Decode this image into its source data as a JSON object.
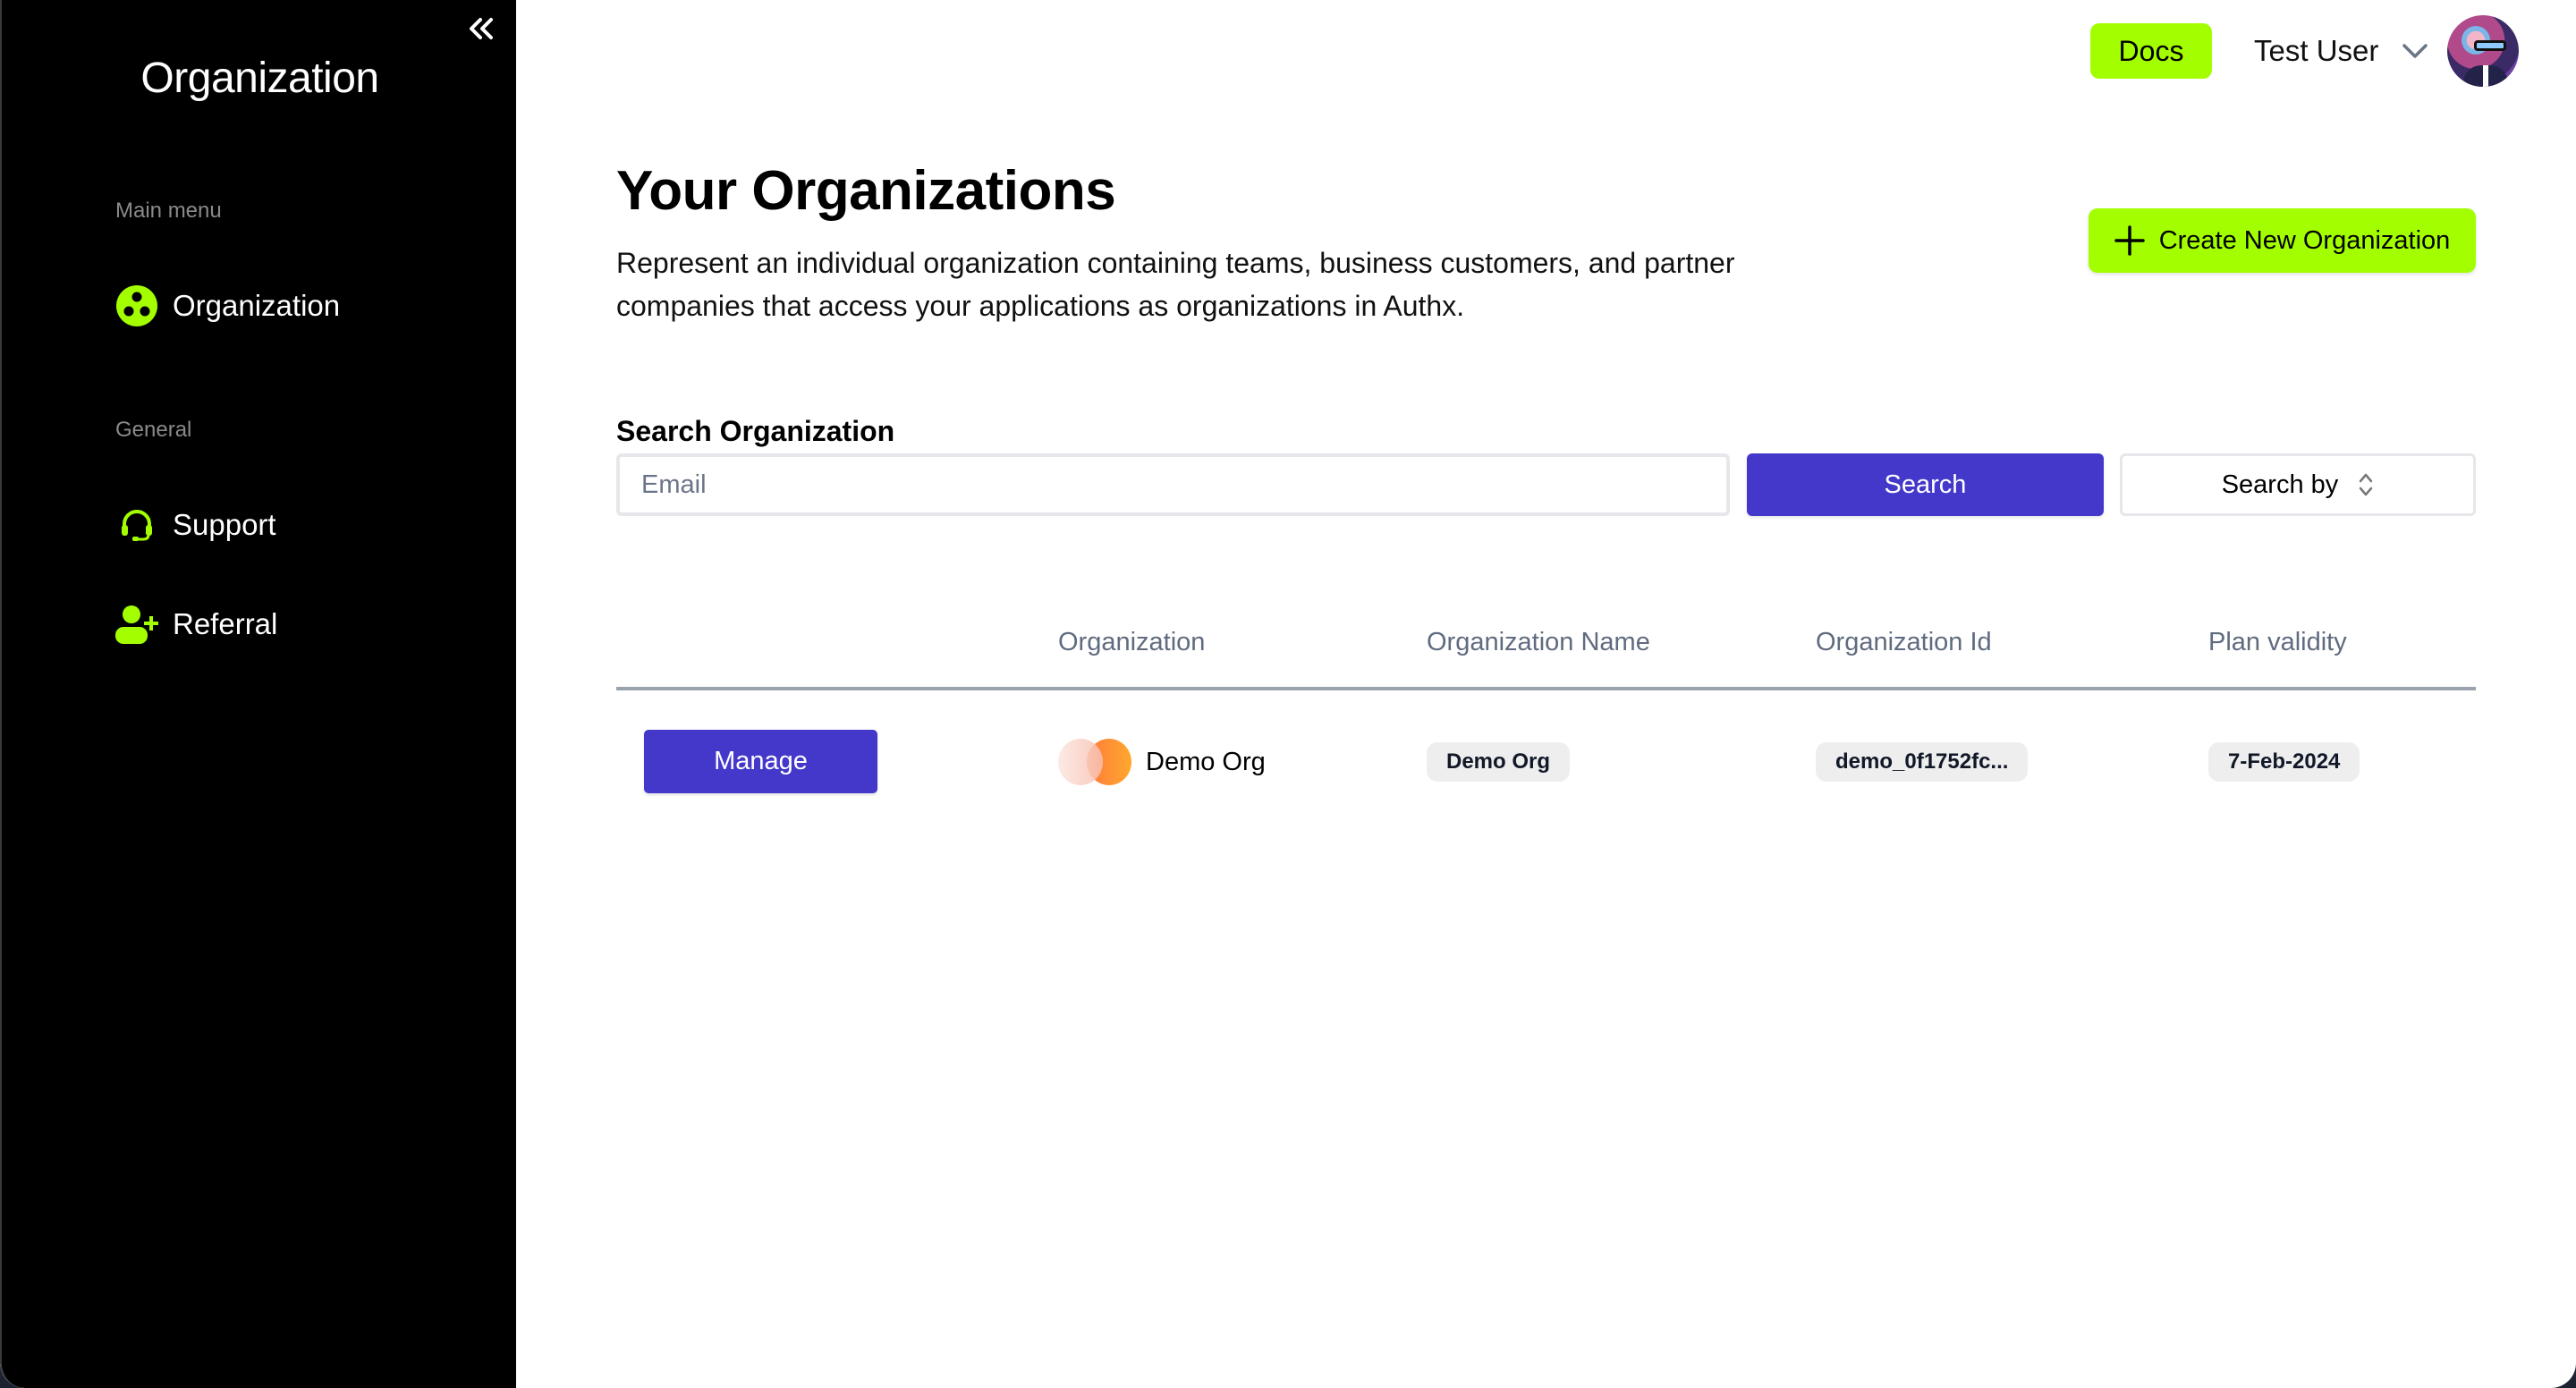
{
  "sidebar": {
    "title": "Organization",
    "collapse_icon": "double-chevron-left-icon",
    "sections": [
      {
        "label": "Main menu",
        "items": [
          {
            "label": "Organization",
            "icon": "organization-icon",
            "active": true
          }
        ]
      },
      {
        "label": "General",
        "items": [
          {
            "label": "Support",
            "icon": "headset-icon"
          },
          {
            "label": "Referral",
            "icon": "user-plus-icon"
          }
        ]
      }
    ]
  },
  "topbar": {
    "docs_label": "Docs",
    "user_name": "Test User",
    "user_menu_icon": "chevron-down-icon",
    "avatar": "user-avatar"
  },
  "header": {
    "title": "Your Organizations",
    "description": "Represent an individual organization containing teams, business customers, and partner companies that access your applications as organizations in Authx.",
    "create_button_label": "Create New Organization"
  },
  "search": {
    "label": "Search Organization",
    "input_value": "",
    "input_placeholder": "Email",
    "search_button_label": "Search",
    "search_by_label": "Search by"
  },
  "table": {
    "columns": [
      "",
      "Organization",
      "Organization Name",
      "Organization Id",
      "Plan validity"
    ],
    "rows": [
      {
        "action_label": "Manage",
        "organization": "Demo Org",
        "organization_name": "Demo Org",
        "organization_id": "demo_0f1752fc...",
        "plan_validity": "7-Feb-2024"
      }
    ]
  },
  "colors": {
    "accent_green": "#a3ff00",
    "primary_indigo": "#4338ca",
    "sidebar_bg": "#000000",
    "header_text": "#5f6b7f"
  }
}
